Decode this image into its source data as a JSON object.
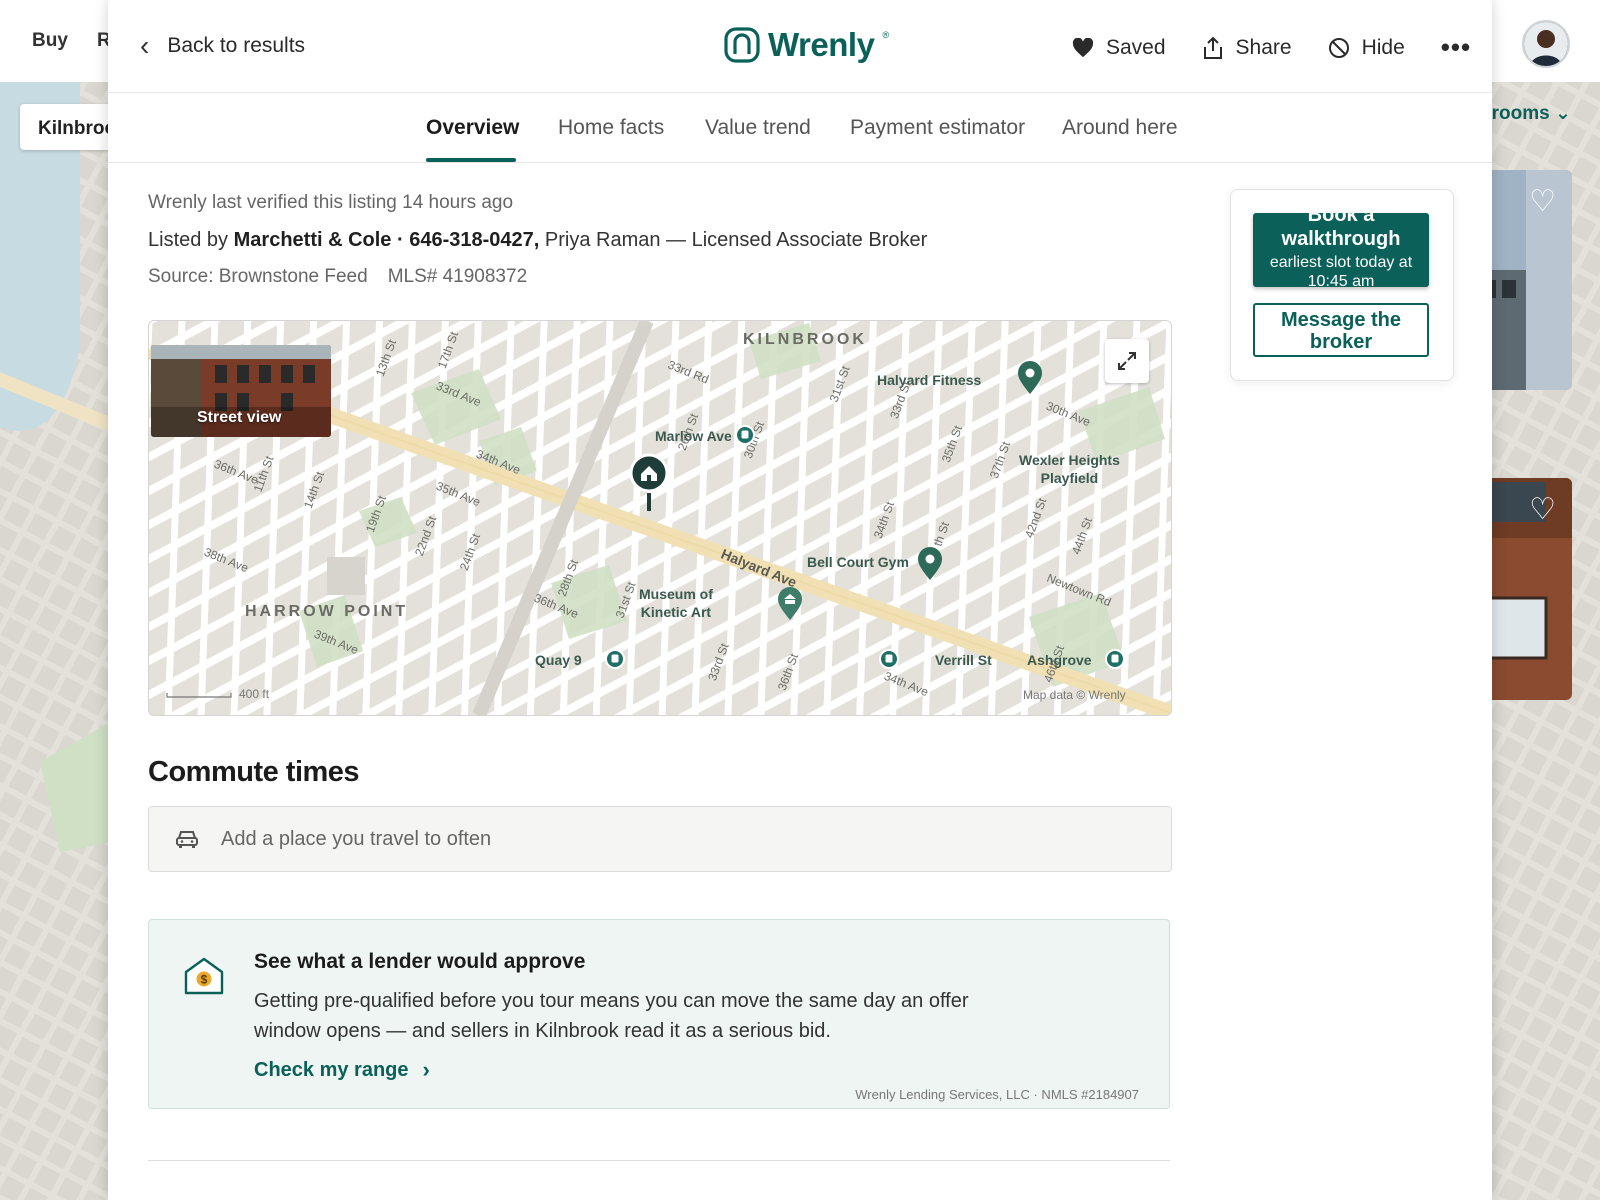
{
  "background": {
    "nav": [
      "Buy",
      "R"
    ],
    "search_value": "Kilnbroo",
    "filter_label": "drooms"
  },
  "header": {
    "back_label": "Back to results",
    "brand": "Wrenly",
    "brand_mark": "®",
    "actions": {
      "saved": "Saved",
      "share": "Share",
      "hide": "Hide",
      "more": "•••"
    }
  },
  "tabs": [
    {
      "label": "Overview",
      "active": true
    },
    {
      "label": "Home facts"
    },
    {
      "label": "Value trend"
    },
    {
      "label": "Payment estimator"
    },
    {
      "label": "Around here"
    }
  ],
  "listing": {
    "verified": "Wrenly last verified this listing 14 hours ago",
    "listed_by_prefix": "Listed by",
    "broker_bold": "Marchetti & Cole · 646-318-0427,",
    "agent": "Priya Raman — Licensed Associate Broker",
    "source": "Source: Brownstone Feed",
    "mls": "MLS# 41908372"
  },
  "map": {
    "street_view_label": "Street view",
    "neighborhoods": [
      "KILNBROOK",
      "HARROW POINT"
    ],
    "pois": [
      "Halyard Fitness",
      "Wexler Heights\nPlayfield",
      "Bell Court Gym",
      "Museum of\nKinetic Art",
      "Marlow Ave",
      "Quay 9",
      "Verrill St",
      "Ashgrove"
    ],
    "streets": [
      "13th St",
      "17th St",
      "33rd Ave",
      "34th Ave",
      "35th Ave",
      "36th Ave",
      "11th St",
      "14th St",
      "19th St",
      "22nd St",
      "24th St",
      "38th Ave",
      "39th Ave",
      "33rd Rd",
      "31st St",
      "33rd St",
      "35th St",
      "37th St",
      "30th Ave",
      "42nd St",
      "44th St",
      "Newtown Rd",
      "34th St",
      "26th St",
      "28th St",
      "30th St",
      "31st St",
      "33rd St",
      "36th St",
      "34th Ave",
      "Halyard Ave",
      "36th Ave",
      "46th St",
      "th St"
    ],
    "scale": "400 ft",
    "attribution": "Map data © Wrenly"
  },
  "commute": {
    "title": "Commute times",
    "placeholder": "Add a place you travel to often"
  },
  "lender": {
    "title": "See what a lender would approve",
    "body": "Getting pre-qualified before you tour means you can move the same day an offer window opens — and sellers in Kilnbrook read it as a serious bid.",
    "cta": "Check my range",
    "disclaimer": "Wrenly Lending Services, LLC · NMLS #2184907"
  },
  "side_card": {
    "book_title": "Book a walkthrough",
    "book_sub": "earliest slot today at 10:45 am",
    "message": "Message the broker"
  },
  "colors": {
    "brand": "#0b6159",
    "panel_bg": "#ffffff",
    "lender_bg": "#eef5f3"
  }
}
